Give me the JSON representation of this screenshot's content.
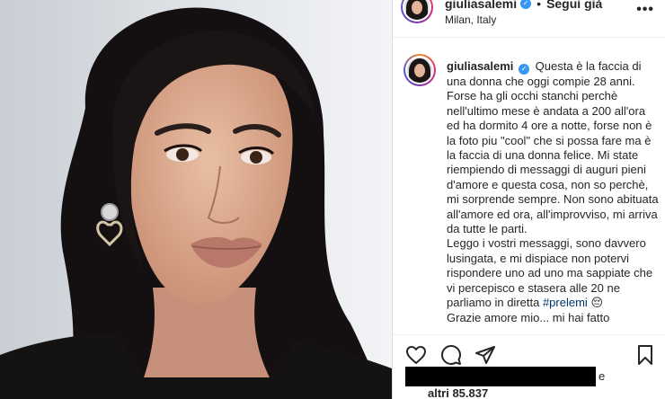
{
  "post": {
    "username": "giuliasalemi",
    "follow_label": "Segui già",
    "separator": "•",
    "location": "Milan, Italy",
    "more_label": "•••",
    "verified_glyph": "✓"
  },
  "caption": {
    "username": "giuliasalemi",
    "lines": [
      "Questa è la faccia di una donna che oggi compie 28 anni. Forse ha gli occhi stanchi perchè nell'ultimo mese è andata a 200 all'ora ed ha dormito 4 ore a notte, forse non è la foto piu \"cool\" che si possa fare ma è la faccia di una donna felice. Mi state riempiendo di messaggi di auguri pieni d'amore e questa cosa, non so perchè, mi sorprende sempre. Non sono abituata all'amore ed ora, all'improvviso, mi arriva da tutte le parti.",
      "Leggo i vostri messaggi, sono davvero lusingata, e mi dispiace non potervi rispondere uno ad uno ma sappiate che vi percepisco e stasera alle 20 ne parliamo in diretta "
    ],
    "hashtag": "#prelemi",
    "emoji": "😔",
    "last_line": "Grazie amore mio... mi hai fatto"
  },
  "actions": {
    "like_icon": "heart-icon",
    "comment_icon": "comment-icon",
    "share_icon": "paper-plane-icon",
    "save_icon": "bookmark-icon"
  },
  "likes": {
    "tail": "e",
    "count_text": "altri 85.837"
  },
  "colors": {
    "verified": "#3897f0",
    "hashtag": "#00376b",
    "text": "#262626"
  }
}
